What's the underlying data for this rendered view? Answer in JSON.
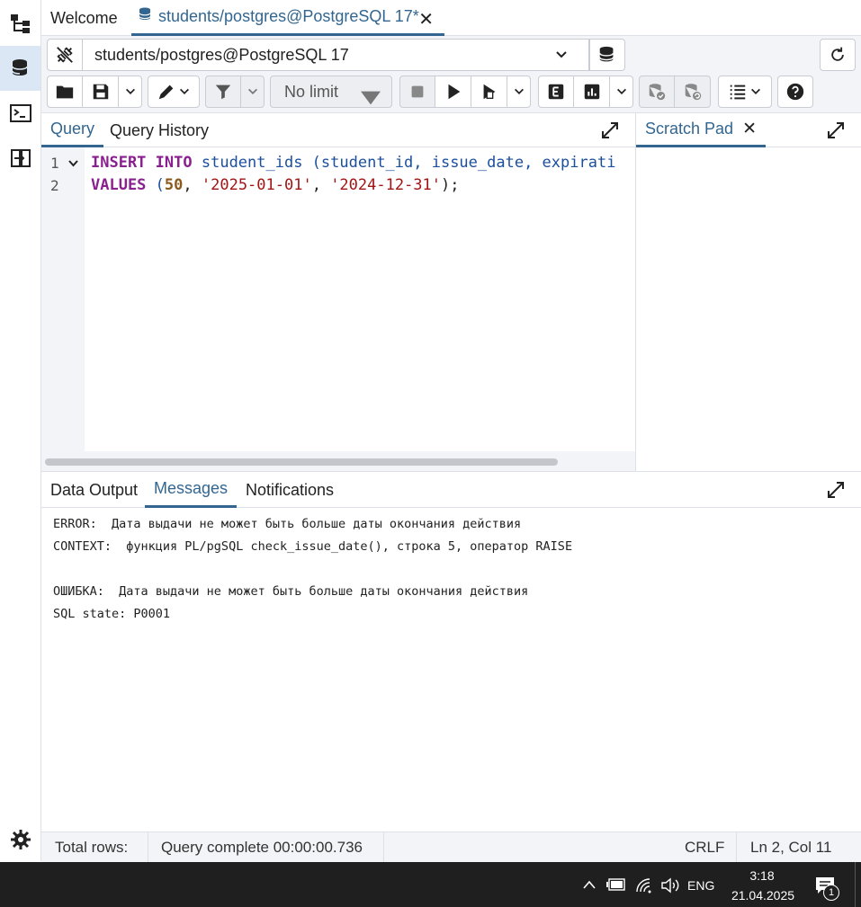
{
  "tabs": {
    "welcome": "Welcome",
    "query_tab": "students/postgres@PostgreSQL 17*"
  },
  "connection": {
    "selected": "students/postgres@PostgreSQL 17"
  },
  "toolbar": {
    "limit_label": "No limit"
  },
  "editor": {
    "tabs": [
      "Query",
      "Query History"
    ],
    "line_numbers": [
      "1",
      "2"
    ],
    "lines": [
      [
        {
          "t": "INSERT",
          "c": "kw"
        },
        {
          "t": " ",
          "c": "pl"
        },
        {
          "t": "INTO",
          "c": "kw"
        },
        {
          "t": " student_ids (student_id, issue_date, expirati",
          "c": "id"
        }
      ],
      [
        {
          "t": "VALUES",
          "c": "kw"
        },
        {
          "t": " (",
          "c": "id"
        },
        {
          "t": "50",
          "c": "num"
        },
        {
          "t": ", ",
          "c": "pl"
        },
        {
          "t": "'2025-01-01'",
          "c": "str"
        },
        {
          "t": ", ",
          "c": "pl"
        },
        {
          "t": "'2024-12-31'",
          "c": "str"
        },
        {
          "t": ");",
          "c": "pl"
        }
      ]
    ]
  },
  "scratch": {
    "title": "Scratch Pad"
  },
  "results": {
    "tabs": [
      "Data Output",
      "Messages",
      "Notifications"
    ],
    "active_tab": "Messages",
    "messages": [
      "ERROR:  Дата выдачи не может быть больше даты окончания действия",
      "CONTEXT:  функция PL/pgSQL check_issue_date(), строка 5, оператор RAISE",
      "",
      "ОШИБКА:  Дата выдачи не может быть больше даты окончания действия",
      "SQL state: P0001"
    ]
  },
  "status": {
    "total_rows": "Total rows:",
    "query_complete": "Query complete 00:00:00.736",
    "line_ending": "CRLF",
    "cursor": "Ln 2, Col 11"
  },
  "taskbar": {
    "lang": "ENG",
    "time": "3:18",
    "date": "21.04.2025",
    "notif_count": "1"
  },
  "colors": {
    "accent": "#326690",
    "keyword": "#8a1f8f",
    "identifier": "#1b4f9c",
    "string": "#a11515",
    "number": "#8a5a1a"
  }
}
